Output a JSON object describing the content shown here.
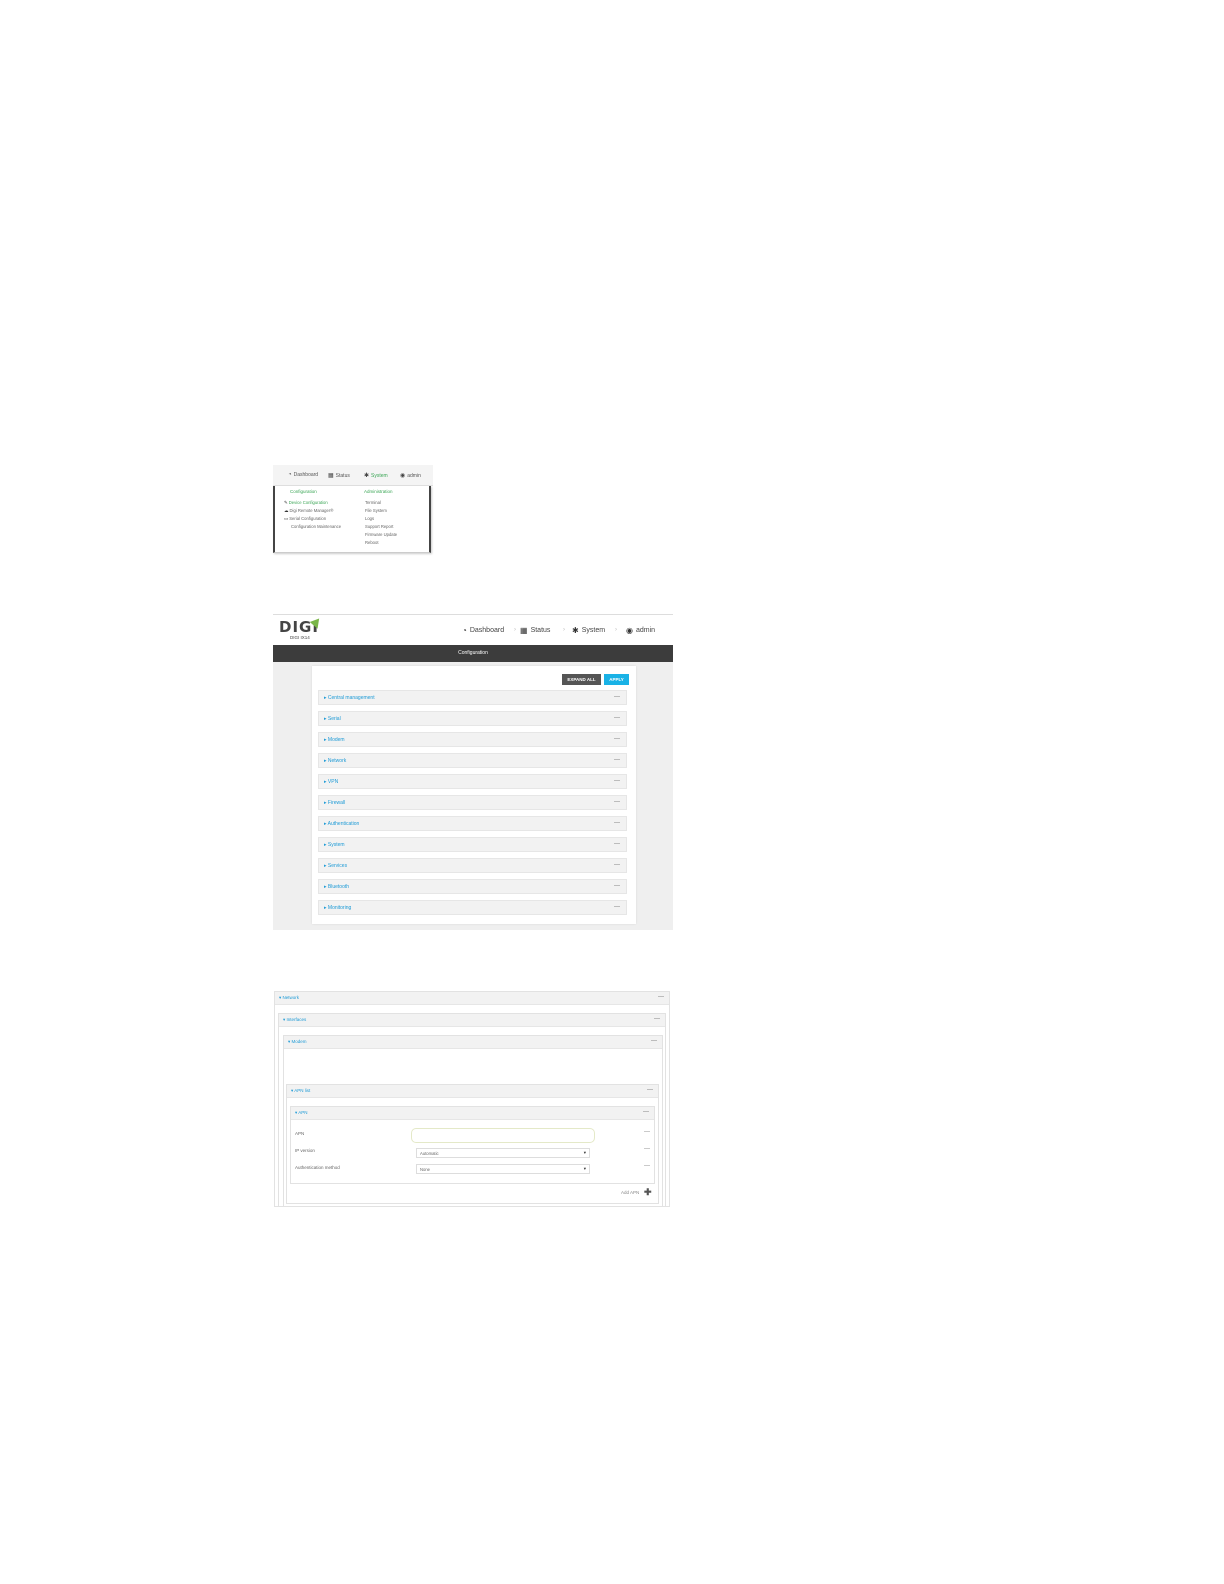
{
  "system_menu": {
    "nav": {
      "dashboard": "Dashboard",
      "status": "Status",
      "system": "System",
      "admin": "admin"
    },
    "columns": {
      "configuration": "Configuration",
      "administration": "Administration"
    },
    "configuration_items": [
      "Device Configuration",
      "Digi Remote Manager®",
      "Serial Configuration",
      "Configuration Maintenance"
    ],
    "administration_items": [
      "Terminal",
      "File System",
      "Logs",
      "Support Report",
      "Firmware Update",
      "Reboot"
    ]
  },
  "config_page": {
    "logo": "DIGI",
    "logo_sub": "DIGI IX14",
    "nav": {
      "dashboard": "Dashboard",
      "status": "Status",
      "system": "System",
      "admin": "admin"
    },
    "title": "Configuration",
    "expand_all": "EXPAND ALL",
    "apply": "APPLY",
    "sections": [
      "Central management",
      "Serial",
      "Modem",
      "Network",
      "VPN",
      "Firewall",
      "Authentication",
      "System",
      "Services",
      "Bluetooth",
      "Monitoring"
    ]
  },
  "apn_page": {
    "network": "Network",
    "interfaces": "Interfaces",
    "modem": "Modem",
    "apn_list": "APN list",
    "apn_group": "APN",
    "fields": {
      "apn_label": "APN",
      "ip_version_label": "IP version",
      "ip_version_value": "Automatic",
      "auth_label": "Authentication method",
      "auth_value": "None"
    },
    "add_apn": "Add APN"
  },
  "colors": {
    "accent_blue": "#1c9ad6",
    "accent_green": "#3aa655",
    "apply_button": "#19b2e6",
    "dark_bar": "#3c3c3c"
  }
}
